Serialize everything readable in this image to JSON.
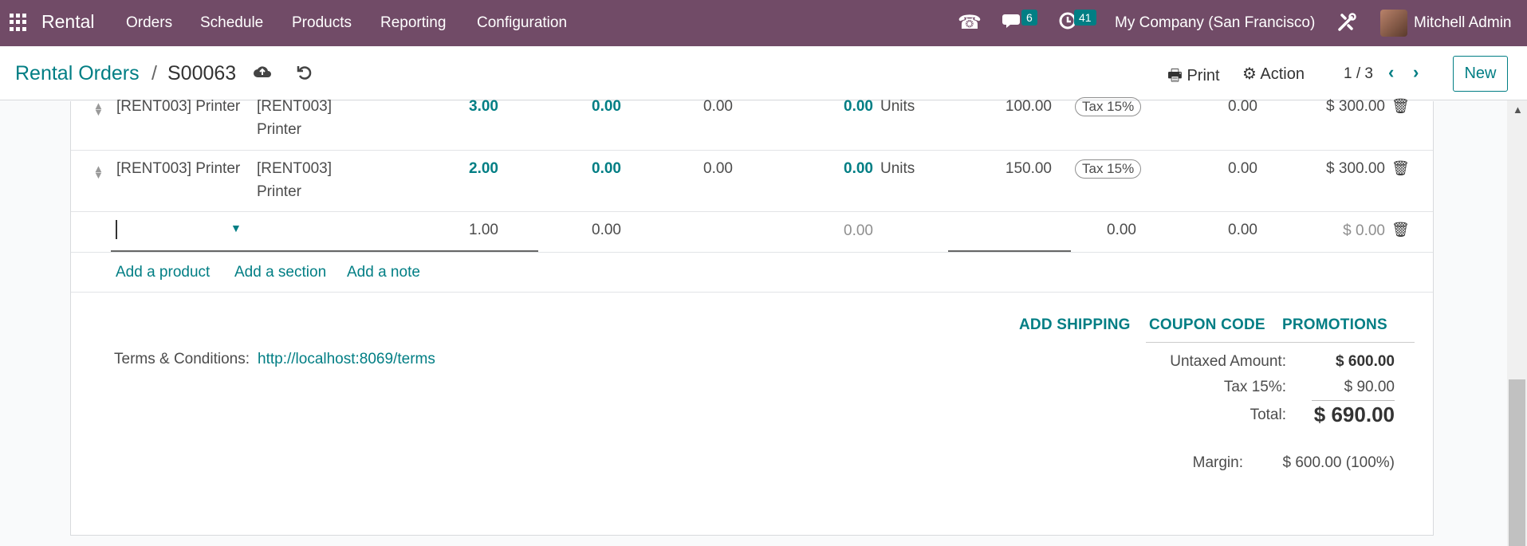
{
  "navbar": {
    "app_name": "Rental",
    "menu": [
      "Orders",
      "Schedule",
      "Products",
      "Reporting",
      "Configuration"
    ],
    "messages_count": "6",
    "activities_count": "41",
    "company": "My Company (San Francisco)",
    "user": "Mitchell Admin",
    "brand_color": "#714b67"
  },
  "control": {
    "breadcrumb_parent": "Rental Orders",
    "breadcrumb_sep": "/",
    "breadcrumb_current": "S00063",
    "print_label": "Print",
    "action_label": "Action",
    "pager": "1 / 3",
    "new_label": "New"
  },
  "lines": [
    {
      "product": "[RENT003] Printer",
      "desc1": "[RENT003]",
      "desc2": "Printer",
      "qty": "3.00",
      "delivered": "0.00",
      "invoiced": "0.00",
      "qty2": "0.00",
      "uom": "Units",
      "price": "100.00",
      "tax": "Tax 15%",
      "disc": "0.00",
      "subtotal": "$ 300.00"
    },
    {
      "product": "[RENT003] Printer",
      "desc1": "[RENT003]",
      "desc2": "Printer",
      "qty": "2.00",
      "delivered": "0.00",
      "invoiced": "0.00",
      "qty2": "0.00",
      "uom": "Units",
      "price": "150.00",
      "tax": "Tax 15%",
      "disc": "0.00",
      "subtotal": "$ 300.00"
    }
  ],
  "new_line": {
    "qty": "1.00",
    "delivered": "0.00",
    "qty2": "0.00",
    "price": "0.00",
    "disc": "0.00",
    "subtotal": "$ 0.00"
  },
  "add_links": {
    "product": "Add a product",
    "section": "Add a section",
    "note": "Add a note"
  },
  "buttons": {
    "shipping": "ADD SHIPPING",
    "coupon": "COUPON CODE",
    "promotions": "PROMOTIONS"
  },
  "terms": {
    "label": "Terms & Conditions:",
    "url": "http://localhost:8069/terms"
  },
  "totals": {
    "untaxed_label": "Untaxed Amount:",
    "untaxed_value": "$ 600.00",
    "tax_label": "Tax 15%:",
    "tax_value": "$ 90.00",
    "total_label": "Total:",
    "total_value": "$ 690.00",
    "margin_label": "Margin:",
    "margin_value": "$ 600.00 (100%)"
  }
}
